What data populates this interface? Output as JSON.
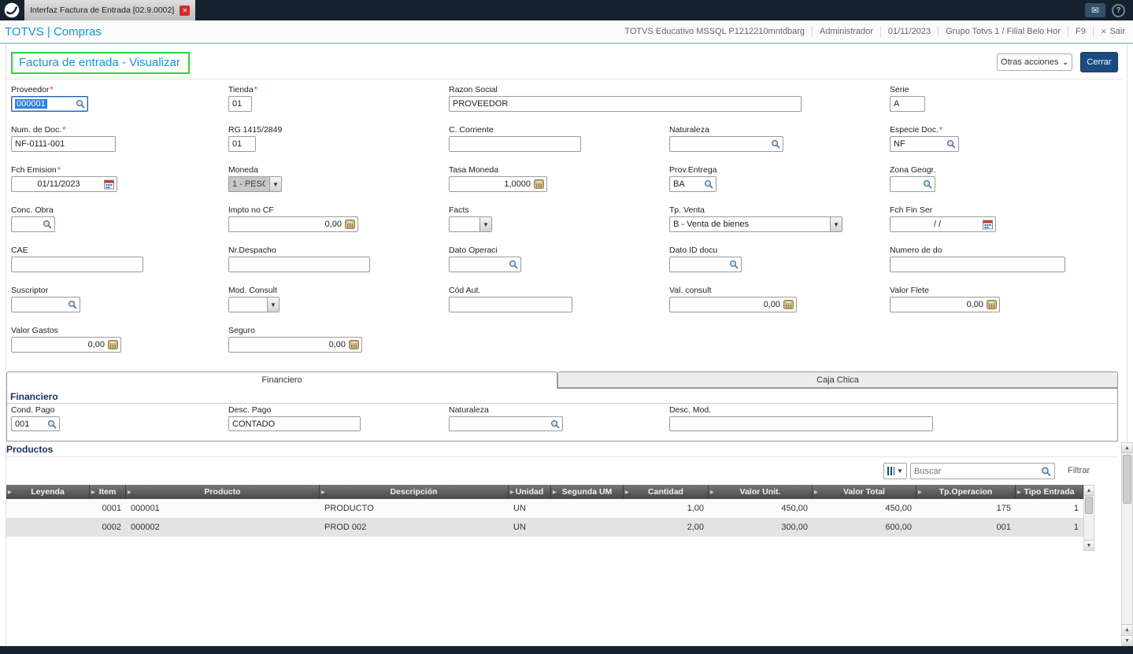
{
  "ui": {
    "required_marker": "*"
  },
  "topbar": {
    "tab_title": "Interfaz Factura de Entrada [02.9.0002]"
  },
  "appbar": {
    "brand": "TOTVS | Compras",
    "env": "TOTVS Educativo MSSQL P1212210mntdbarg",
    "user": "Administrador",
    "date": "01/11/2023",
    "branch": "Grupo Totvs 1 / Filial Belo Hor",
    "f9": "F9",
    "sair": "Sair"
  },
  "page": {
    "title": "Factura de entrada - Visualizar",
    "otras_acciones": "Otras acciones",
    "cerrar": "Cerrar"
  },
  "fields": {
    "proveedor": {
      "label": "Proveedor",
      "value": "000001"
    },
    "tienda": {
      "label": "Tienda",
      "value": "01"
    },
    "razon_social": {
      "label": "Razon Social",
      "value": "PROVEEDOR"
    },
    "serie": {
      "label": "Serie",
      "value": "A"
    },
    "num_doc": {
      "label": "Num. de Doc.",
      "value": "NF-0111-001"
    },
    "rg": {
      "label": "RG 1415/2849",
      "value": "01"
    },
    "c_corriente": {
      "label": "C. Corriente",
      "value": ""
    },
    "naturaleza": {
      "label": "Naturaleza",
      "value": ""
    },
    "especie_doc": {
      "label": "Especie Doc.",
      "value": "NF"
    },
    "fch_emision": {
      "label": "Fch Emision",
      "value": "01/11/2023"
    },
    "moneda": {
      "label": "Moneda",
      "value": "1 - PESC"
    },
    "tasa_moneda": {
      "label": "Tasa Moneda",
      "value": "1,0000"
    },
    "prov_entrega": {
      "label": "Prov.Entrega",
      "value": "BA"
    },
    "zona_geogr": {
      "label": "Zona Geogr.",
      "value": ""
    },
    "conc_obra": {
      "label": "Conc. Obra",
      "value": ""
    },
    "impto_no_cf": {
      "label": "Impto no CF",
      "value": "0,00"
    },
    "facts": {
      "label": "Facts",
      "value": ""
    },
    "tp_venta": {
      "label": "Tp. Venta",
      "value": "B - Venta de bienes"
    },
    "fch_fin_ser": {
      "label": "Fch Fin Ser",
      "value": "/  /"
    },
    "cae": {
      "label": "CAE",
      "value": ""
    },
    "nr_despacho": {
      "label": "Nr.Despacho",
      "value": ""
    },
    "dato_operaci": {
      "label": "Dato Operaci",
      "value": ""
    },
    "dato_id_docu": {
      "label": "Dato ID docu",
      "value": ""
    },
    "numero_de_do": {
      "label": "Numero de do",
      "value": ""
    },
    "suscriptor": {
      "label": "Suscriptor",
      "value": ""
    },
    "mod_consult": {
      "label": "Mod. Consult",
      "value": ""
    },
    "cod_aut": {
      "label": "Cód Aut.",
      "value": ""
    },
    "val_consult": {
      "label": "Val. consult",
      "value": "0,00"
    },
    "valor_flete": {
      "label": "Valor Flete",
      "value": "0,00"
    },
    "valor_gastos": {
      "label": "Valor Gastos",
      "value": "0,00"
    },
    "seguro": {
      "label": "Seguro",
      "value": "0,00"
    }
  },
  "tabs": {
    "financiero": "Financiero",
    "caja_chica": "Caja Chica"
  },
  "financiero": {
    "title": "Financiero",
    "cond_pago": {
      "label": "Cond. Pago",
      "value": "001"
    },
    "desc_pago": {
      "label": "Desc. Pago",
      "value": "CONTADO"
    },
    "naturaleza": {
      "label": "Naturaleza",
      "value": ""
    },
    "desc_mod": {
      "label": "Desc. Mod.",
      "value": ""
    }
  },
  "productos": {
    "title": "Productos",
    "buscar_placeholder": "Buscar",
    "filtrar": "Filtrar",
    "columns": [
      "Leyenda",
      "Item",
      "Producto",
      "Descripción",
      "Unidad",
      "Segunda UM",
      "Cantidad",
      "Valor Unit.",
      "Valor Total",
      "Tp.Operacion",
      "Tipo Entrada"
    ],
    "rows": [
      {
        "leyenda": "",
        "item": "0001",
        "producto": "000001",
        "descripcion": "PRODUCTO",
        "unidad": "UN",
        "segunda_um": "",
        "cantidad": "1,00",
        "valor_unit": "450,00",
        "valor_total": "450,00",
        "tp_operacion": "175",
        "tipo_entrada": "1"
      },
      {
        "leyenda": "",
        "item": "0002",
        "producto": "000002",
        "descripcion": "PROD 002",
        "unidad": "UN",
        "segunda_um": "",
        "cantidad": "2,00",
        "valor_unit": "300,00",
        "valor_total": "600,00",
        "tp_operacion": "001",
        "tipo_entrada": "1"
      }
    ]
  }
}
